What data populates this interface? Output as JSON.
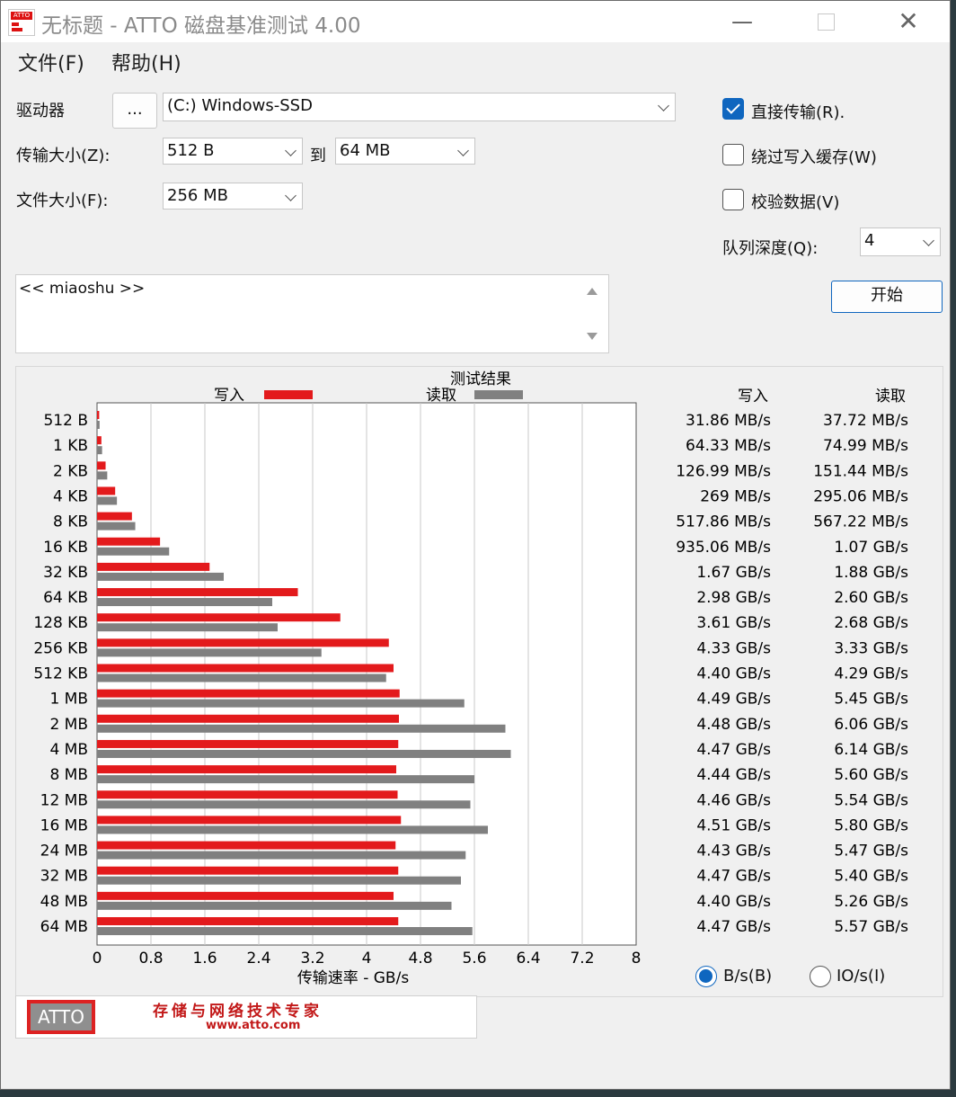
{
  "window": {
    "title": "无标题 - ATTO 磁盘基准测试 4.00",
    "min_glyph": "—",
    "close_glyph": "✕"
  },
  "menu": [
    {
      "label": "文件(F)"
    },
    {
      "label": "帮助(H)"
    }
  ],
  "settings": {
    "drive_label": "驱动器",
    "browse_label": "...",
    "drive_value": "(C:) Windows-SSD",
    "transfer_size_label": "传输大小(Z):",
    "transfer_from": "512 B",
    "to_label": "到",
    "transfer_to": "64 MB",
    "file_size_label": "文件大小(F):",
    "file_size": "256 MB",
    "direct_io_label": "直接传输(R).",
    "direct_io_checked": true,
    "bypass_cache_label": "绕过写入缓存(W)",
    "bypass_cache_checked": false,
    "verify_label": "校验数据(V)",
    "verify_checked": false,
    "queue_depth_label": "队列深度(Q):",
    "queue_depth": "4",
    "start_label": "开始",
    "description": "<< miaoshu >>"
  },
  "results": {
    "title": "测试结果",
    "write_legend": "写入",
    "read_legend": "读取",
    "col_write": "写入",
    "col_read": "读取",
    "write_values": [
      "31.86 MB/s",
      "64.33 MB/s",
      "126.99 MB/s",
      "269 MB/s",
      "517.86 MB/s",
      "935.06 MB/s",
      "1.67 GB/s",
      "2.98 GB/s",
      "3.61 GB/s",
      "4.33 GB/s",
      "4.40 GB/s",
      "4.49 GB/s",
      "4.48 GB/s",
      "4.47 GB/s",
      "4.44 GB/s",
      "4.46 GB/s",
      "4.51 GB/s",
      "4.43 GB/s",
      "4.47 GB/s",
      "4.40 GB/s",
      "4.47 GB/s"
    ],
    "read_values": [
      "37.72 MB/s",
      "74.99 MB/s",
      "151.44 MB/s",
      "295.06 MB/s",
      "567.22 MB/s",
      "1.07 GB/s",
      "1.88 GB/s",
      "2.60 GB/s",
      "2.68 GB/s",
      "3.33 GB/s",
      "4.29 GB/s",
      "5.45 GB/s",
      "6.06 GB/s",
      "6.14 GB/s",
      "5.60 GB/s",
      "5.54 GB/s",
      "5.80 GB/s",
      "5.47 GB/s",
      "5.40 GB/s",
      "5.26 GB/s",
      "5.57 GB/s"
    ],
    "unit_bs_label": "B/s(B)",
    "unit_ios_label": "IO/s(I)",
    "unit_bs_selected": true
  },
  "chart_data": {
    "type": "bar",
    "orientation": "horizontal",
    "title": "测试结果",
    "xlabel": "传输速率 - GB/s",
    "xlim": [
      0,
      8
    ],
    "xticks": [
      "0",
      "0.8",
      "1.6",
      "2.4",
      "3.2",
      "4",
      "4.8",
      "5.6",
      "6.4",
      "7.2",
      "8"
    ],
    "grid": true,
    "legend": "top",
    "categories": [
      "512 B",
      "1 KB",
      "2 KB",
      "4 KB",
      "8 KB",
      "16 KB",
      "32 KB",
      "64 KB",
      "128 KB",
      "256 KB",
      "512 KB",
      "1 MB",
      "2 MB",
      "4 MB",
      "8 MB",
      "12 MB",
      "16 MB",
      "24 MB",
      "32 MB",
      "48 MB",
      "64 MB"
    ],
    "series": [
      {
        "name": "写入",
        "color": "#e31a1c",
        "values": [
          0.03186,
          0.06433,
          0.12699,
          0.269,
          0.51786,
          0.93506,
          1.67,
          2.98,
          3.61,
          4.33,
          4.4,
          4.49,
          4.48,
          4.47,
          4.44,
          4.46,
          4.51,
          4.43,
          4.47,
          4.4,
          4.47
        ]
      },
      {
        "name": "读取",
        "color": "#808080",
        "values": [
          0.03772,
          0.07499,
          0.15144,
          0.29506,
          0.56722,
          1.07,
          1.88,
          2.6,
          2.68,
          3.33,
          4.29,
          5.45,
          6.06,
          6.14,
          5.6,
          5.54,
          5.8,
          5.47,
          5.4,
          5.26,
          5.57
        ]
      }
    ]
  },
  "banner": {
    "logo_text": "ATTO",
    "slogan": "存储与网络技术专家",
    "url": "www.atto.com"
  },
  "colors": {
    "accent": "#0f66bf",
    "write": "#e31a1c",
    "read": "#808080"
  }
}
